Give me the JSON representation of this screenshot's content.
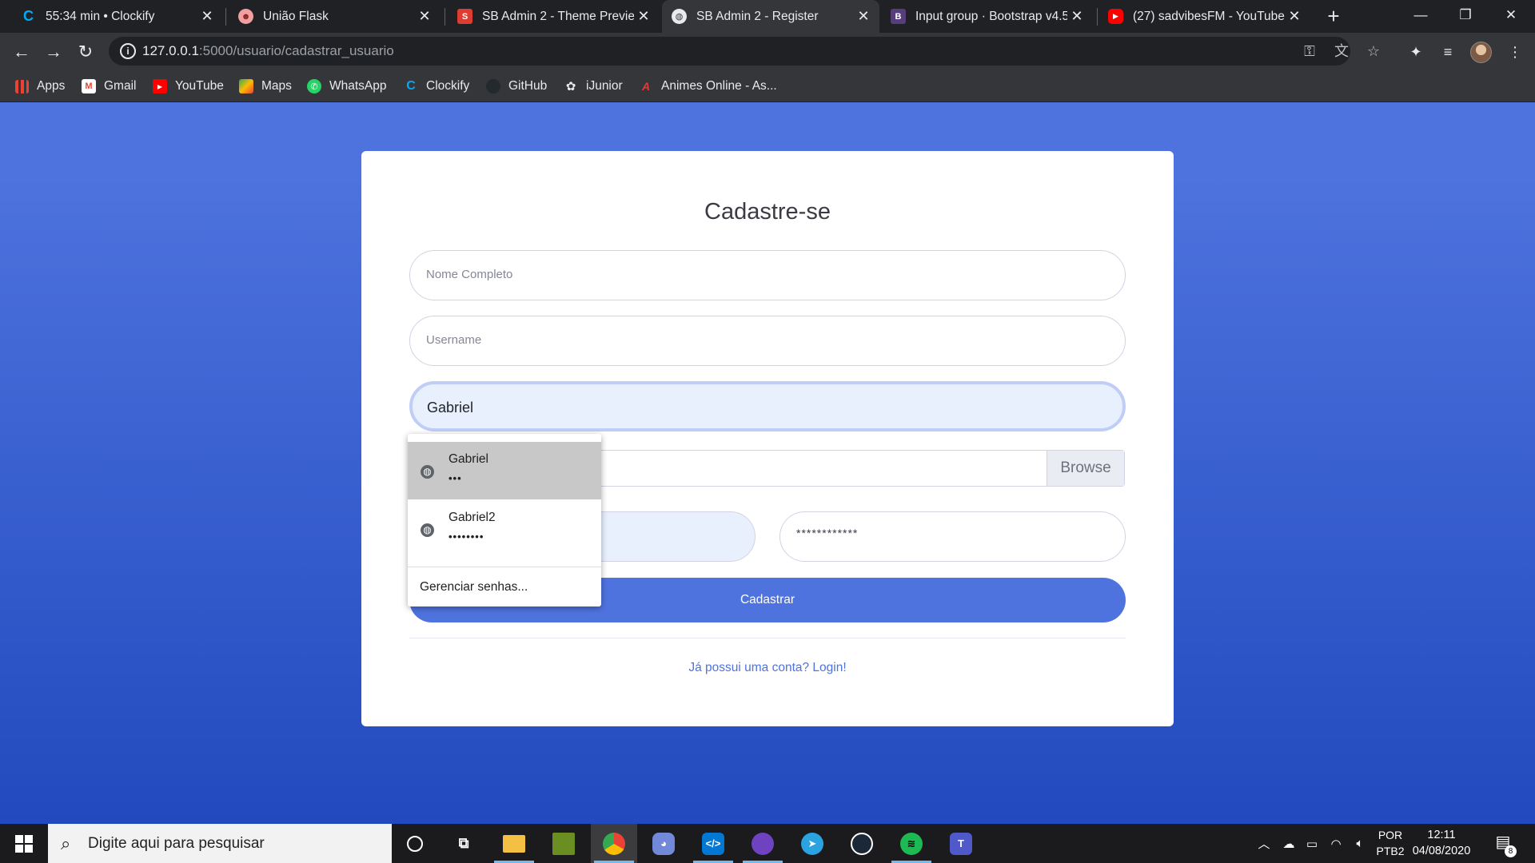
{
  "browser": {
    "tabs": [
      {
        "title": "55:34 min • Clockify",
        "icon": "clockify-icon",
        "color": "#03a9f4"
      },
      {
        "title": "União Flask",
        "icon": "flask-logo-icon",
        "color": "#e57373"
      },
      {
        "title": "SB Admin 2 - Theme Preview",
        "icon": "startbootstrap-icon",
        "color": "#dd3d31"
      },
      {
        "title": "SB Admin 2 - Register",
        "icon": "globe-icon",
        "color": "#9aa0a6"
      },
      {
        "title": "Input group · Bootstrap v4.5",
        "icon": "bootstrap-icon",
        "color": "#563d7c"
      },
      {
        "title": "(27) sadvibesFM - YouTube",
        "icon": "youtube-icon",
        "color": "#ff0000"
      }
    ],
    "url_host": "127.0.0.1",
    "url_rest": ":5000/usuario/cadastrar_usuario",
    "bookmarks": [
      {
        "label": "Apps",
        "icon": "apps-grid-icon"
      },
      {
        "label": "Gmail",
        "icon": "gmail-icon"
      },
      {
        "label": "YouTube",
        "icon": "youtube-icon"
      },
      {
        "label": "Maps",
        "icon": "maps-icon"
      },
      {
        "label": "WhatsApp",
        "icon": "whatsapp-icon"
      },
      {
        "label": "Clockify",
        "icon": "clockify-icon"
      },
      {
        "label": "GitHub",
        "icon": "github-icon"
      },
      {
        "label": "iJunior",
        "icon": "ijunior-icon"
      },
      {
        "label": "Animes Online - As...",
        "icon": "animes-icon"
      }
    ]
  },
  "page": {
    "title": "Cadastre-se",
    "fields": {
      "full_name_placeholder": "Nome Completo",
      "username_placeholder": "Username",
      "email_value": "Gabriel",
      "browse_label": "Browse",
      "repeat_password_mask": "************"
    },
    "submit_label": "Cadastrar",
    "login_link": "Já possui uma conta? Login!",
    "accent": "#4e73df"
  },
  "autofill": {
    "items": [
      {
        "username": "Gabriel",
        "password_mask": "•••"
      },
      {
        "username": "Gabriel2",
        "password_mask": "••••••••"
      }
    ],
    "manage_label": "Gerenciar senhas..."
  },
  "taskbar": {
    "search_placeholder": "Digite aqui para pesquisar",
    "language": "POR",
    "layout": "PTB2",
    "time": "12:11",
    "date": "04/08/2020",
    "notifications": "8"
  }
}
